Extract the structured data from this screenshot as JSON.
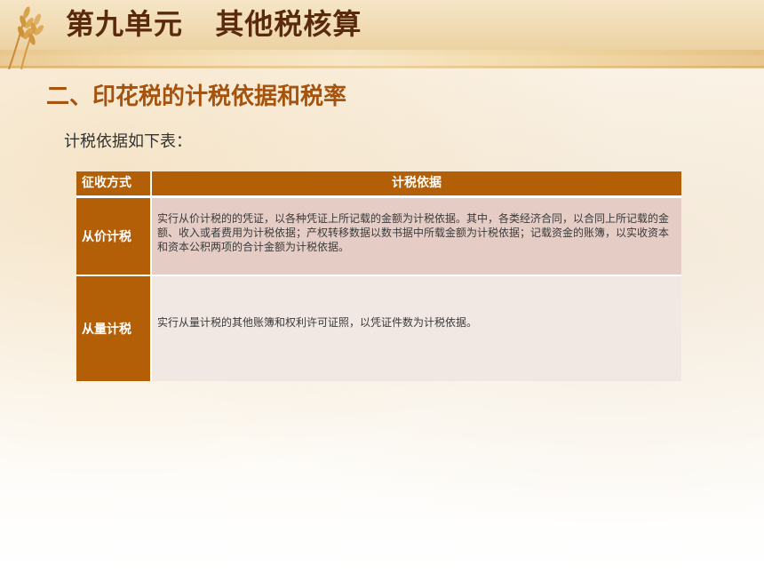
{
  "slide": {
    "title": "第九单元   其他税核算",
    "section_heading": "二、印花税的计税依据和税率",
    "intro": "计税依据如下表："
  },
  "table": {
    "headers": [
      "征收方式",
      "计税依据"
    ],
    "rows": [
      {
        "method": "从价计税",
        "basis": "实行从价计税的的凭证，以各种凭证上所记载的金额为计税依据。其中，各类经济合同，以合同上所记载的金额、收入或者费用为计税依据；产权转移数据以数书据中所载金额为计税依据；记载资金的账簿，以实收资本和资本公积两项的合计金额为计税依据。"
      },
      {
        "method": "从量计税",
        "basis": "实行从量计税的其他账簿和权利许可证照，以凭证件数为计税依据。"
      }
    ]
  },
  "colors": {
    "header_fill": "#b35f08",
    "row1_fill": "#e5cdc6",
    "row2_fill": "#f1e7e3",
    "title_color": "#5a2a0c",
    "heading_color": "#a6530d"
  },
  "icons": [
    "wheat-icon"
  ]
}
